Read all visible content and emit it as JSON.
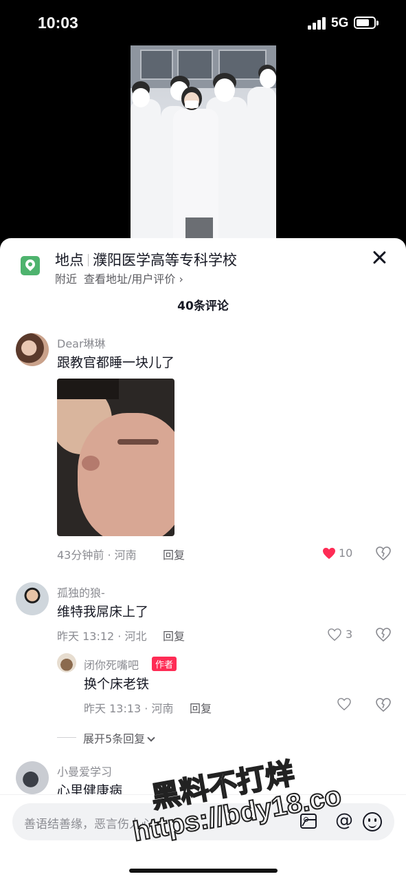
{
  "status_bar": {
    "time": "10:03",
    "network": "5G"
  },
  "location": {
    "label": "地点",
    "name": "濮阳医学高等专科学校",
    "nearby": "附近",
    "details_link": "查看地址/用户评价 ›"
  },
  "comments_header": {
    "count_text": "40条评论"
  },
  "comments": [
    {
      "username": "Dear琳琳",
      "text": "跟教官都睡一块儿了",
      "meta": "43分钟前 · 河南",
      "reply_label": "回复",
      "likes": "10",
      "liked": true
    },
    {
      "username": "孤独的狼-",
      "text": "维特我屌床上了",
      "meta": "昨天 13:12 · 河北",
      "reply_label": "回复",
      "likes": "3",
      "liked": false,
      "replies": [
        {
          "username": "闭你死嘴吧",
          "badge": "作者",
          "text": "换个床老铁",
          "meta": "昨天 13:13 · 河南",
          "reply_label": "回复"
        }
      ],
      "expand_text": "展开5条回复"
    },
    {
      "username": "小曼爱学习",
      "text": "心里健康病"
    }
  ],
  "input": {
    "placeholder": "善语结善缘，恶言伤人心"
  },
  "watermark": {
    "line1": "黑料不打烊",
    "line2": "https://bdy18.co"
  },
  "colors": {
    "like_red": "#fe2c55",
    "location_green": "#4eb36e",
    "author_badge": "#fe2c55"
  }
}
